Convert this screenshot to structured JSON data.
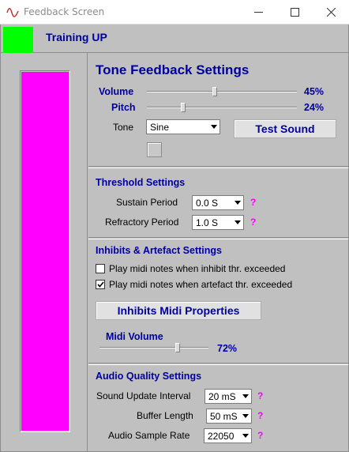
{
  "window": {
    "title": "Feedback Screen"
  },
  "header": {
    "mode_title": "Training UP",
    "status_color": "#00ff00"
  },
  "level_bar": {
    "fill_fraction": 1.0,
    "color": "#ff00ff"
  },
  "tone": {
    "title": "Tone Feedback Settings",
    "volume": {
      "label": "Volume",
      "value_text": "45%",
      "value": 45
    },
    "pitch": {
      "label": "Pitch",
      "value_text": "24%",
      "value": 24
    },
    "tone_label": "Tone",
    "tone_value": "Sine",
    "test_sound_label": "Test Sound"
  },
  "threshold": {
    "title": "Threshold Settings",
    "sustain": {
      "label": "Sustain Period",
      "value": "0.0 S"
    },
    "refractory": {
      "label": "Refractory Period",
      "value": "1.0 S"
    },
    "help": "?"
  },
  "inhibits": {
    "title": "Inhibits & Artefact Settings",
    "cb_inhibit": {
      "label": "Play midi notes when inhibit thr. exceeded",
      "checked": false
    },
    "cb_artefact": {
      "label": "Play midi notes when artefact thr. exceeded",
      "checked": true
    },
    "midi_props_label": "Inhibits Midi Properties",
    "midi_volume": {
      "label": "Midi Volume",
      "value_text": "72%",
      "value": 72
    }
  },
  "audio": {
    "title": "Audio Quality Settings",
    "update_interval": {
      "label": "Sound Update Interval",
      "value": "20 mS"
    },
    "buffer_length": {
      "label": "Buffer Length",
      "value": "50 mS"
    },
    "sample_rate": {
      "label": "Audio Sample Rate",
      "value": "22050"
    },
    "help": "?"
  },
  "colors": {
    "accent_blue": "#0000a0",
    "help_magenta": "#ff00ff"
  }
}
